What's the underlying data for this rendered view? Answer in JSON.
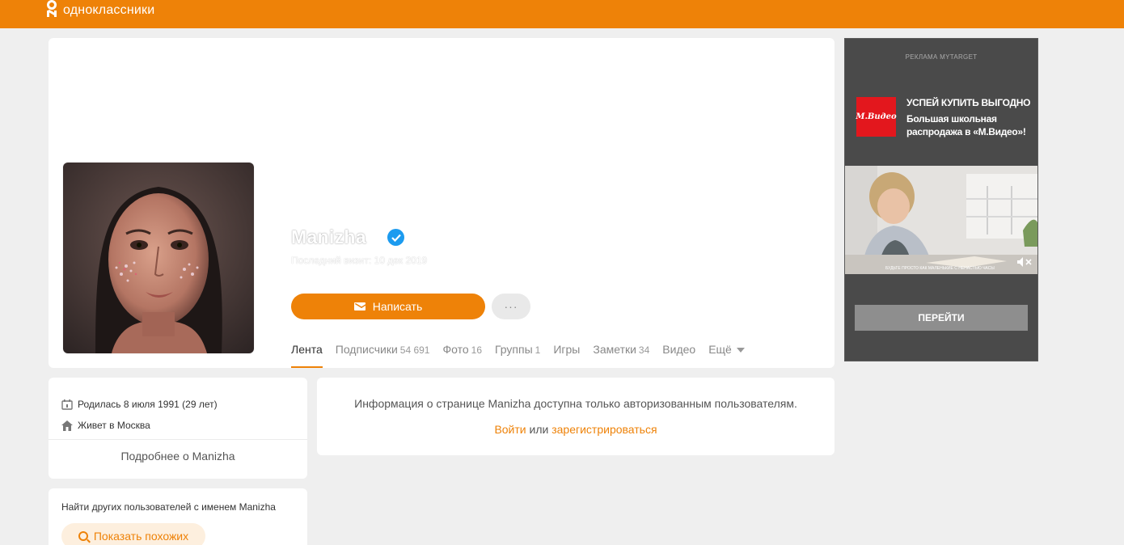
{
  "header": {
    "logo_text": "одноклассники"
  },
  "profile": {
    "name": "Manizha",
    "last_visit": "Последний визит: 10 дек 2019",
    "write_label": "Написать",
    "more_label": "···",
    "tabs": [
      {
        "label": "Лента",
        "count": ""
      },
      {
        "label": "Подписчики",
        "count": "54 691"
      },
      {
        "label": "Фото",
        "count": "16"
      },
      {
        "label": "Группы",
        "count": "1"
      },
      {
        "label": "Игры",
        "count": ""
      },
      {
        "label": "Заметки",
        "count": "34"
      },
      {
        "label": "Видео",
        "count": ""
      },
      {
        "label": "Ещё",
        "count": ""
      }
    ]
  },
  "info": {
    "born": "Родилась 8 июля 1991 (29 лет)",
    "lives": "Живет в Москва",
    "more_about": "Подробнее о Manizha"
  },
  "find": {
    "title": "Найти других пользователей с именем Manizha",
    "button": "Показать похожих"
  },
  "auth": {
    "message": "Информация о странице Manizha доступна только авторизованным пользователям.",
    "login": "Войти",
    "or": "или",
    "register": "зарегистрироваться"
  },
  "ad": {
    "label": "РЕКЛАМА MYTARGET",
    "logo_text": "М.Видео",
    "headline": "УСПЕЙ КУПИТЬ ВЫГОДНО",
    "description": "Большая школьная распродажа в «М.Видео»!",
    "video_caption": "БУДЬТЕ ПРОСТО КАК МАЛЕНЬКИЕ С НЕНАСТЬЮ ЧАСЫ",
    "go_label": "ПЕРЕЙТИ"
  },
  "colors": {
    "accent": "#ee8208",
    "verified": "#1c9bef",
    "ad_bg": "#4a4a4a"
  }
}
